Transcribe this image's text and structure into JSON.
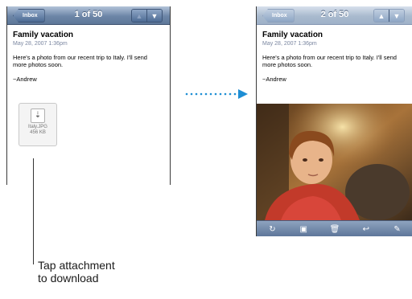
{
  "left_screen": {
    "back_label": "Inbox",
    "count": "1 of 50",
    "up_icon": "▲",
    "down_icon": "▼"
  },
  "right_screen": {
    "back_label": "Inbox",
    "count": "2 of 50",
    "up_icon": "▲",
    "down_icon": "▼"
  },
  "email": {
    "subject": "Family vacation",
    "date": "May 28, 2007 1:36pm",
    "body": "Here's a photo from our recent trip to Italy. I'll send more photos soon.",
    "signature": "~Andrew"
  },
  "attachment": {
    "icon": "download-icon",
    "glyph": "⇣",
    "name": "Italy.JPG",
    "size": "456 KB"
  },
  "toolbar": {
    "items": [
      {
        "name": "refresh-icon",
        "glyph": "↻"
      },
      {
        "name": "move-icon",
        "glyph": "▣"
      },
      {
        "name": "trash-icon",
        "glyph": "🗑"
      },
      {
        "name": "reply-icon",
        "glyph": "↩"
      },
      {
        "name": "compose-icon",
        "glyph": "✎"
      }
    ]
  },
  "callout": {
    "line1": "Tap attachment",
    "line2": "to download"
  },
  "colors": {
    "navbar": "#6d86a7",
    "arrow": "#1e8ed4",
    "date_text": "#7a86a0"
  }
}
